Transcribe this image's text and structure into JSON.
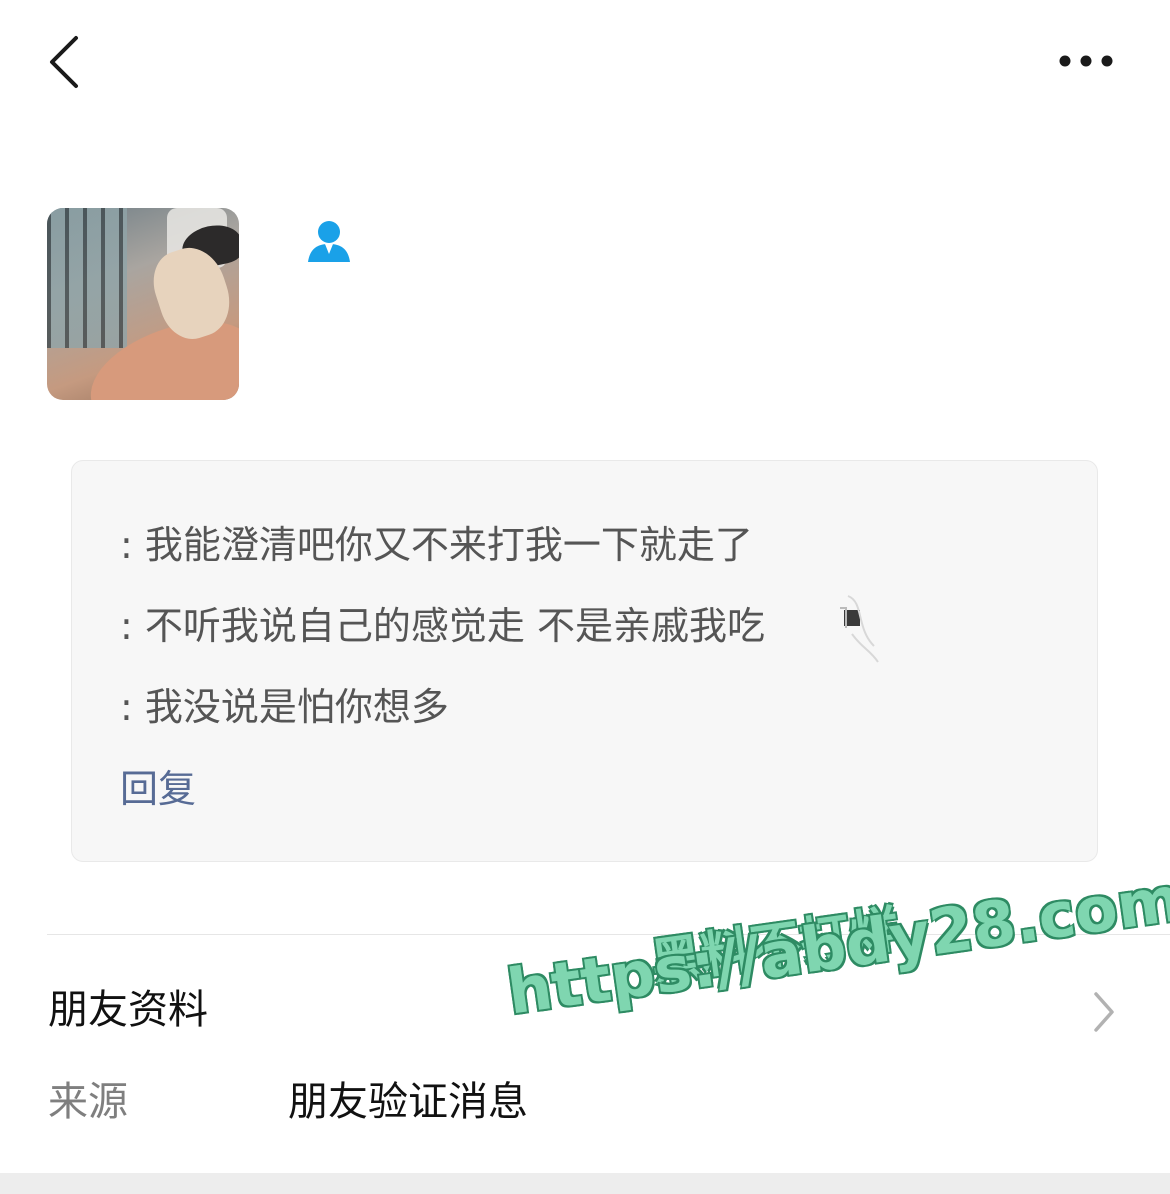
{
  "header": {
    "back_icon": "chevron-left-icon",
    "more_icon": "more-horizontal-icon"
  },
  "profile": {
    "avatar": "profile-photo",
    "contact_icon": "contact-person-icon",
    "contact_icon_color": "#1aa1e8"
  },
  "message_card": {
    "lines": [
      ": 我能澄清吧你又不来打我一下就走了",
      ": 不听我说自己的感觉走 不是亲戚我吃",
      ": 我没说是怕你想多"
    ],
    "reply_label": "回复",
    "reply_color": "#576b95"
  },
  "friend_info": {
    "label": "朋友资料",
    "chevron_icon": "chevron-right-icon"
  },
  "source": {
    "key": "来源",
    "value": "朋友验证消息"
  },
  "watermark": {
    "line1": "黑料不打烊",
    "line2": "https://abdy28.com"
  }
}
